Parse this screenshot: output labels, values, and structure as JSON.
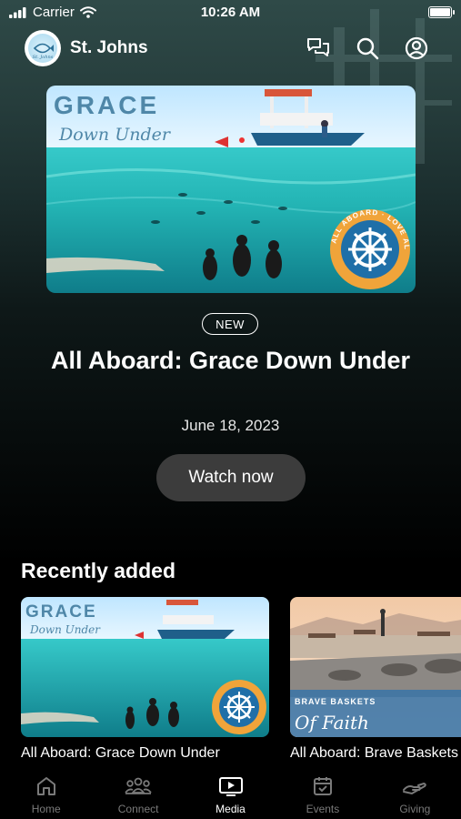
{
  "status_bar": {
    "carrier": "Carrier",
    "time": "10:26 AM"
  },
  "header": {
    "church_name": "St. Johns",
    "logo_text": "St. Johns",
    "icons": [
      "chat-icon",
      "search-icon",
      "profile-icon"
    ]
  },
  "hero": {
    "art_title": "GRACE",
    "art_subtitle": "Down Under",
    "seal_text": "ALL ABOARD · LOVE ALL · SERVE ALL",
    "badge": "NEW",
    "title": "All Aboard: Grace Down Under",
    "date": "June 18, 2023",
    "button_label": "Watch now"
  },
  "recently_added": {
    "title": "Recently added",
    "items": [
      {
        "title": "All Aboard: Grace Down Under",
        "art_title": "GRACE",
        "art_subtitle": "Down Under"
      },
      {
        "title": "All Aboard: Brave Baskets of Faith",
        "art_title": "BRAVE BASKETS",
        "art_subtitle": "Of Faith"
      }
    ]
  },
  "tabs": [
    {
      "label": "Home",
      "icon": "home-icon"
    },
    {
      "label": "Connect",
      "icon": "people-icon"
    },
    {
      "label": "Media",
      "icon": "media-icon",
      "active": true
    },
    {
      "label": "Events",
      "icon": "calendar-icon"
    },
    {
      "label": "Giving",
      "icon": "giving-icon"
    }
  ],
  "colors": {
    "background_top": "#2f4a48",
    "background_bottom": "#000000",
    "button": "#3c3c3c",
    "inactive_tab": "#7a7a7a",
    "seal_orange": "#f0a43a",
    "seal_blue": "#1f6fa8"
  }
}
